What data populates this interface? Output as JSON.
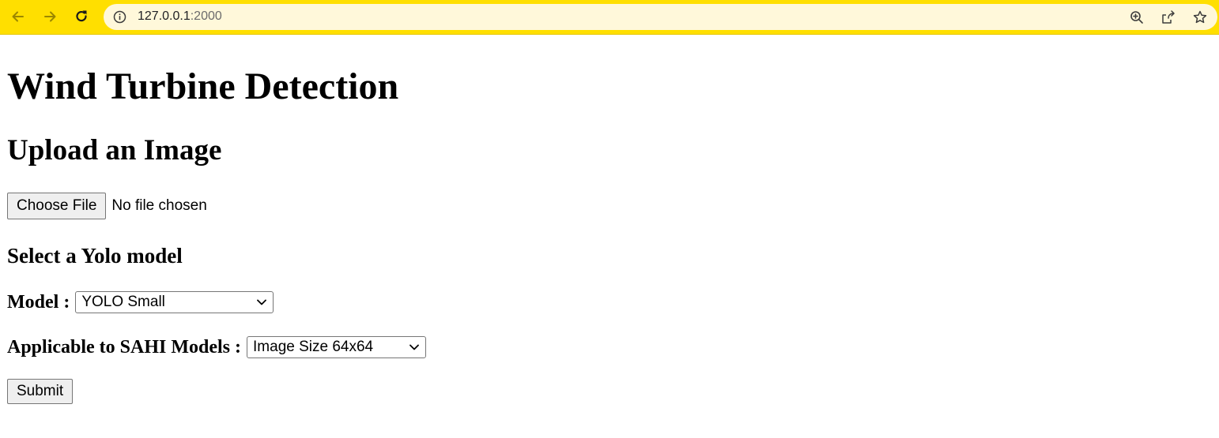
{
  "browser": {
    "url_host": "127.0.0.1",
    "url_port": ":2000",
    "icons": [
      "back-arrow-icon",
      "forward-arrow-icon",
      "reload-icon",
      "info-icon",
      "zoom-icon",
      "share-icon",
      "star-icon"
    ],
    "toolbar_color": "#ffdf00",
    "omnibox_color": "#fff8da"
  },
  "page": {
    "title": "Wind Turbine Detection",
    "upload_heading": "Upload an Image",
    "file_button_label": "Choose File",
    "file_status": "No file chosen",
    "model_heading": "Select a Yolo model",
    "model_label": "Model :",
    "model_selected": "YOLO Small",
    "sahi_label": "Applicable to SAHI Models :",
    "sahi_selected": "Image Size 64x64",
    "submit_label": "Submit"
  }
}
